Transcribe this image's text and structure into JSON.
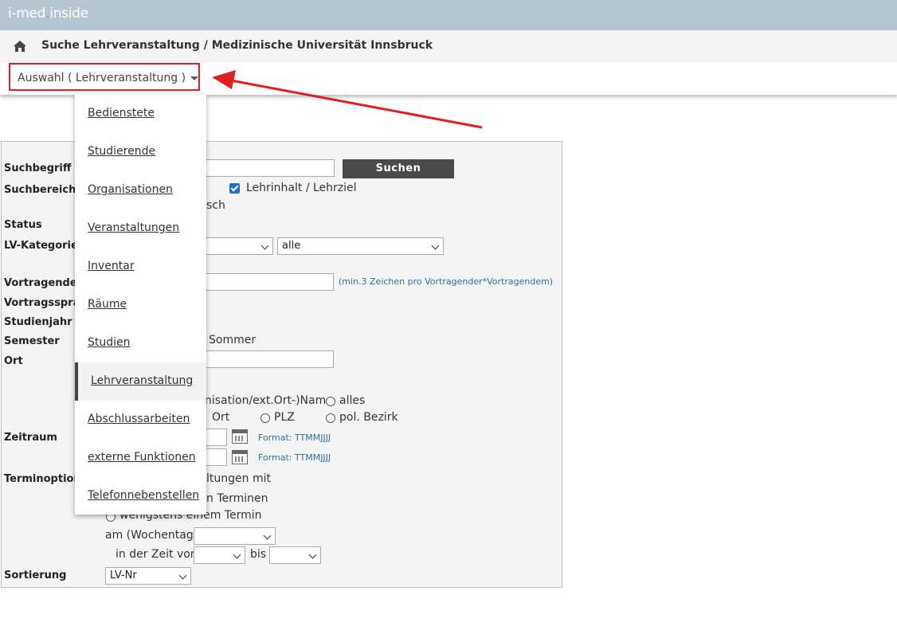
{
  "header": {
    "logo": {
      "part1": "i-med",
      "part2": ".",
      "part3": "inside"
    },
    "page_title": "Suche Lehrveranstaltung / Medizinische Universität Innsbruck"
  },
  "selector": {
    "label": "Auswahl ( Lehrveranstaltung )",
    "icon": "caret-down-icon"
  },
  "annotation": {
    "color": "#e02020"
  },
  "menu": {
    "items": [
      {
        "label": "Bedienstete"
      },
      {
        "label": "Studierende"
      },
      {
        "label": "Organisationen"
      },
      {
        "label": "Veranstaltungen"
      },
      {
        "label": "Inventar"
      },
      {
        "label": "Räume"
      },
      {
        "label": "Studien"
      },
      {
        "label": "Lehrveranstaltung"
      },
      {
        "label": "Abschlussarbeiten"
      },
      {
        "label": "externe Funktionen"
      },
      {
        "label": "Telefonnebenstellen"
      }
    ],
    "active": "Lehrveranstaltung"
  },
  "form": {
    "labels": {
      "suchbegriff": "Suchbegriff",
      "suchbereich": "Suchbereich",
      "status": "Status",
      "lv_kategorie": "LV-Kategorie",
      "vortragende": "Vortragende",
      "vortragssprache": "Vortragssprac",
      "studienjahr": "Studienjahr",
      "semester": "Semester",
      "ort": "Ort",
      "zeitraum": "Zeitraum",
      "terminoption": "Terminoption",
      "sortierung": "Sortierung"
    },
    "search_button": "Suchen",
    "suchbereich": {
      "checkbox_label": "Lehrinhalt / Lehrziel",
      "partial_text": "sch"
    },
    "lv_kategorie_second": "alle",
    "vortragende_hint": "(min.3 Zeichen pro Vortragender*Vortragendem)",
    "semester_option": "Sommer",
    "ort_options": {
      "partial_name": "nisation/ext.Ort-)Name",
      "alles": "alles",
      "ort": "Ort",
      "plz": "PLZ",
      "bezirk": "pol. Bezirk"
    },
    "date_format_hint": "Format: TTMMJJJJ",
    "termin": {
      "partial_line1": "ltungen mit",
      "partial_line2": "n Terminen",
      "line3": "wenigstens einem Termin",
      "wochentag": "am (Wochentag)",
      "zeit_von": "in der Zeit von",
      "bis": "bis"
    },
    "sortierung_value": "LV-Nr"
  }
}
